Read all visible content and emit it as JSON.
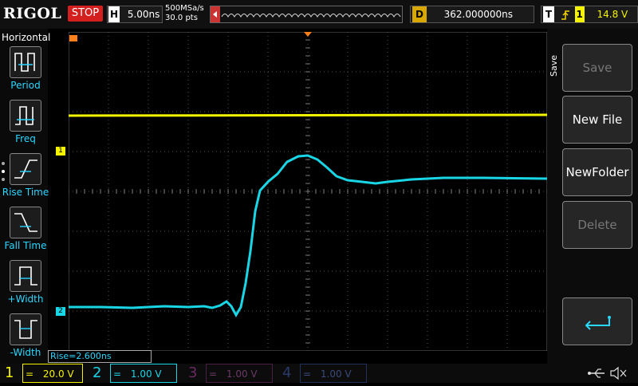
{
  "top": {
    "logo": "RIGOL",
    "run_state": "STOP",
    "h_label": "H",
    "timebase": "5.00ns",
    "sample_rate": "500MSa/s",
    "mem_depth": "30.0  pts",
    "d_label": "D",
    "delay": "362.000000ns",
    "t_label": "T",
    "trigger_source": "1",
    "trigger_level": "14.8 V"
  },
  "left_menu": {
    "title": "Horizontal",
    "items": [
      {
        "label": "Period",
        "icon": "period-icon"
      },
      {
        "label": "Freq",
        "icon": "frequency-icon"
      },
      {
        "label": "Rise Time",
        "icon": "rise-time-icon"
      },
      {
        "label": "Fall Time",
        "icon": "fall-time-icon"
      },
      {
        "label": "+Width",
        "icon": "positive-width-icon"
      },
      {
        "label": "-Width",
        "icon": "negative-width-icon"
      }
    ]
  },
  "measurement": "Rise=2.600ns",
  "right_menu": {
    "title": "Save",
    "buttons": [
      {
        "label": "Save",
        "enabled": false
      },
      {
        "label": "New File",
        "enabled": true
      },
      {
        "label": "NewFolder",
        "enabled": true
      },
      {
        "label": "Delete",
        "enabled": false
      }
    ],
    "back_icon": "return-arrow-icon"
  },
  "channels": [
    {
      "num": "1",
      "coupling": "=",
      "scale": "20.0 V",
      "color": "#f4f400",
      "active": true
    },
    {
      "num": "2",
      "coupling": "=",
      "scale": "1.00 V",
      "color": "#19d6e6",
      "active": true
    },
    {
      "num": "3",
      "coupling": "=",
      "scale": "1.00 V",
      "color": "#c23ab0",
      "active": false
    },
    {
      "num": "4",
      "coupling": "=",
      "scale": "1.00 V",
      "color": "#3a6ad8",
      "active": false
    }
  ],
  "markers": {
    "ch1": "1",
    "ch2": "2"
  },
  "status_icons": [
    "usb-icon",
    "mute-icon"
  ],
  "colors": {
    "ch1": "#f4f400",
    "ch2": "#19d6e6",
    "stop": "#d41f1f",
    "accent": "#2ad7ff",
    "trigger": "#ff7f1a"
  }
}
